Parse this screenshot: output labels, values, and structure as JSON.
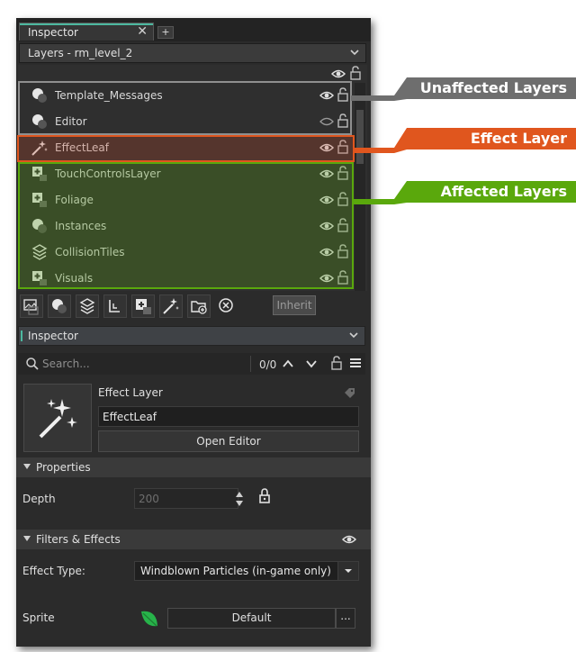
{
  "tab": {
    "label": "Inspector",
    "close": "✕",
    "plus": "+"
  },
  "room_dropdown": {
    "value": "Layers - rm_level_2"
  },
  "layers": [
    {
      "name": "Template_Messages",
      "icon": "instance-layer-icon",
      "visible": true,
      "locked": false
    },
    {
      "name": "Editor",
      "icon": "instance-layer-icon",
      "visible": false,
      "locked": false
    },
    {
      "name": "EffectLeaf",
      "icon": "effect-layer-icon",
      "visible": true,
      "locked": false
    },
    {
      "name": "TouchControlsLayer",
      "icon": "asset-layer-icon",
      "visible": true,
      "locked": false
    },
    {
      "name": "Foliage",
      "icon": "asset-layer-icon",
      "visible": true,
      "locked": false
    },
    {
      "name": "Instances",
      "icon": "instance-layer-icon",
      "visible": true,
      "locked": false
    },
    {
      "name": "CollisionTiles",
      "icon": "tile-layer-icon",
      "visible": true,
      "locked": false
    },
    {
      "name": "Visuals",
      "icon": "asset-layer-icon",
      "visible": true,
      "locked": false
    }
  ],
  "toolbar": {
    "buttons": [
      "background-layer-icon",
      "instance-layer-icon",
      "tile-layer-icon",
      "path-layer-icon",
      "asset-layer-icon",
      "effect-layer-icon",
      "folder-add-icon",
      "delete-icon"
    ],
    "inherit_label": "Inherit"
  },
  "inspector": {
    "header": "Inspector",
    "search_placeholder": "Search...",
    "search_count": "0/0",
    "layer_type": "Effect Layer",
    "layer_name": "EffectLeaf",
    "open_editor": "Open Editor",
    "properties_label": "Properties",
    "depth_label": "Depth",
    "depth_value": "200",
    "filters_label": "Filters & Effects",
    "effect_type_label": "Effect Type:",
    "effect_type_value": "Windblown Particles (in-game only)",
    "sprite_label": "Sprite",
    "sprite_value": "Default",
    "sprite_more": "..."
  },
  "callouts": {
    "unaffected": "Unaffected Layers",
    "effect": "Effect Layer",
    "affected": "Affected Layers"
  },
  "colors": {
    "unaffected": "#6e6e6e",
    "effect": "#e0561e",
    "affected": "#5aa80c",
    "accent": "#4cb8a0"
  }
}
